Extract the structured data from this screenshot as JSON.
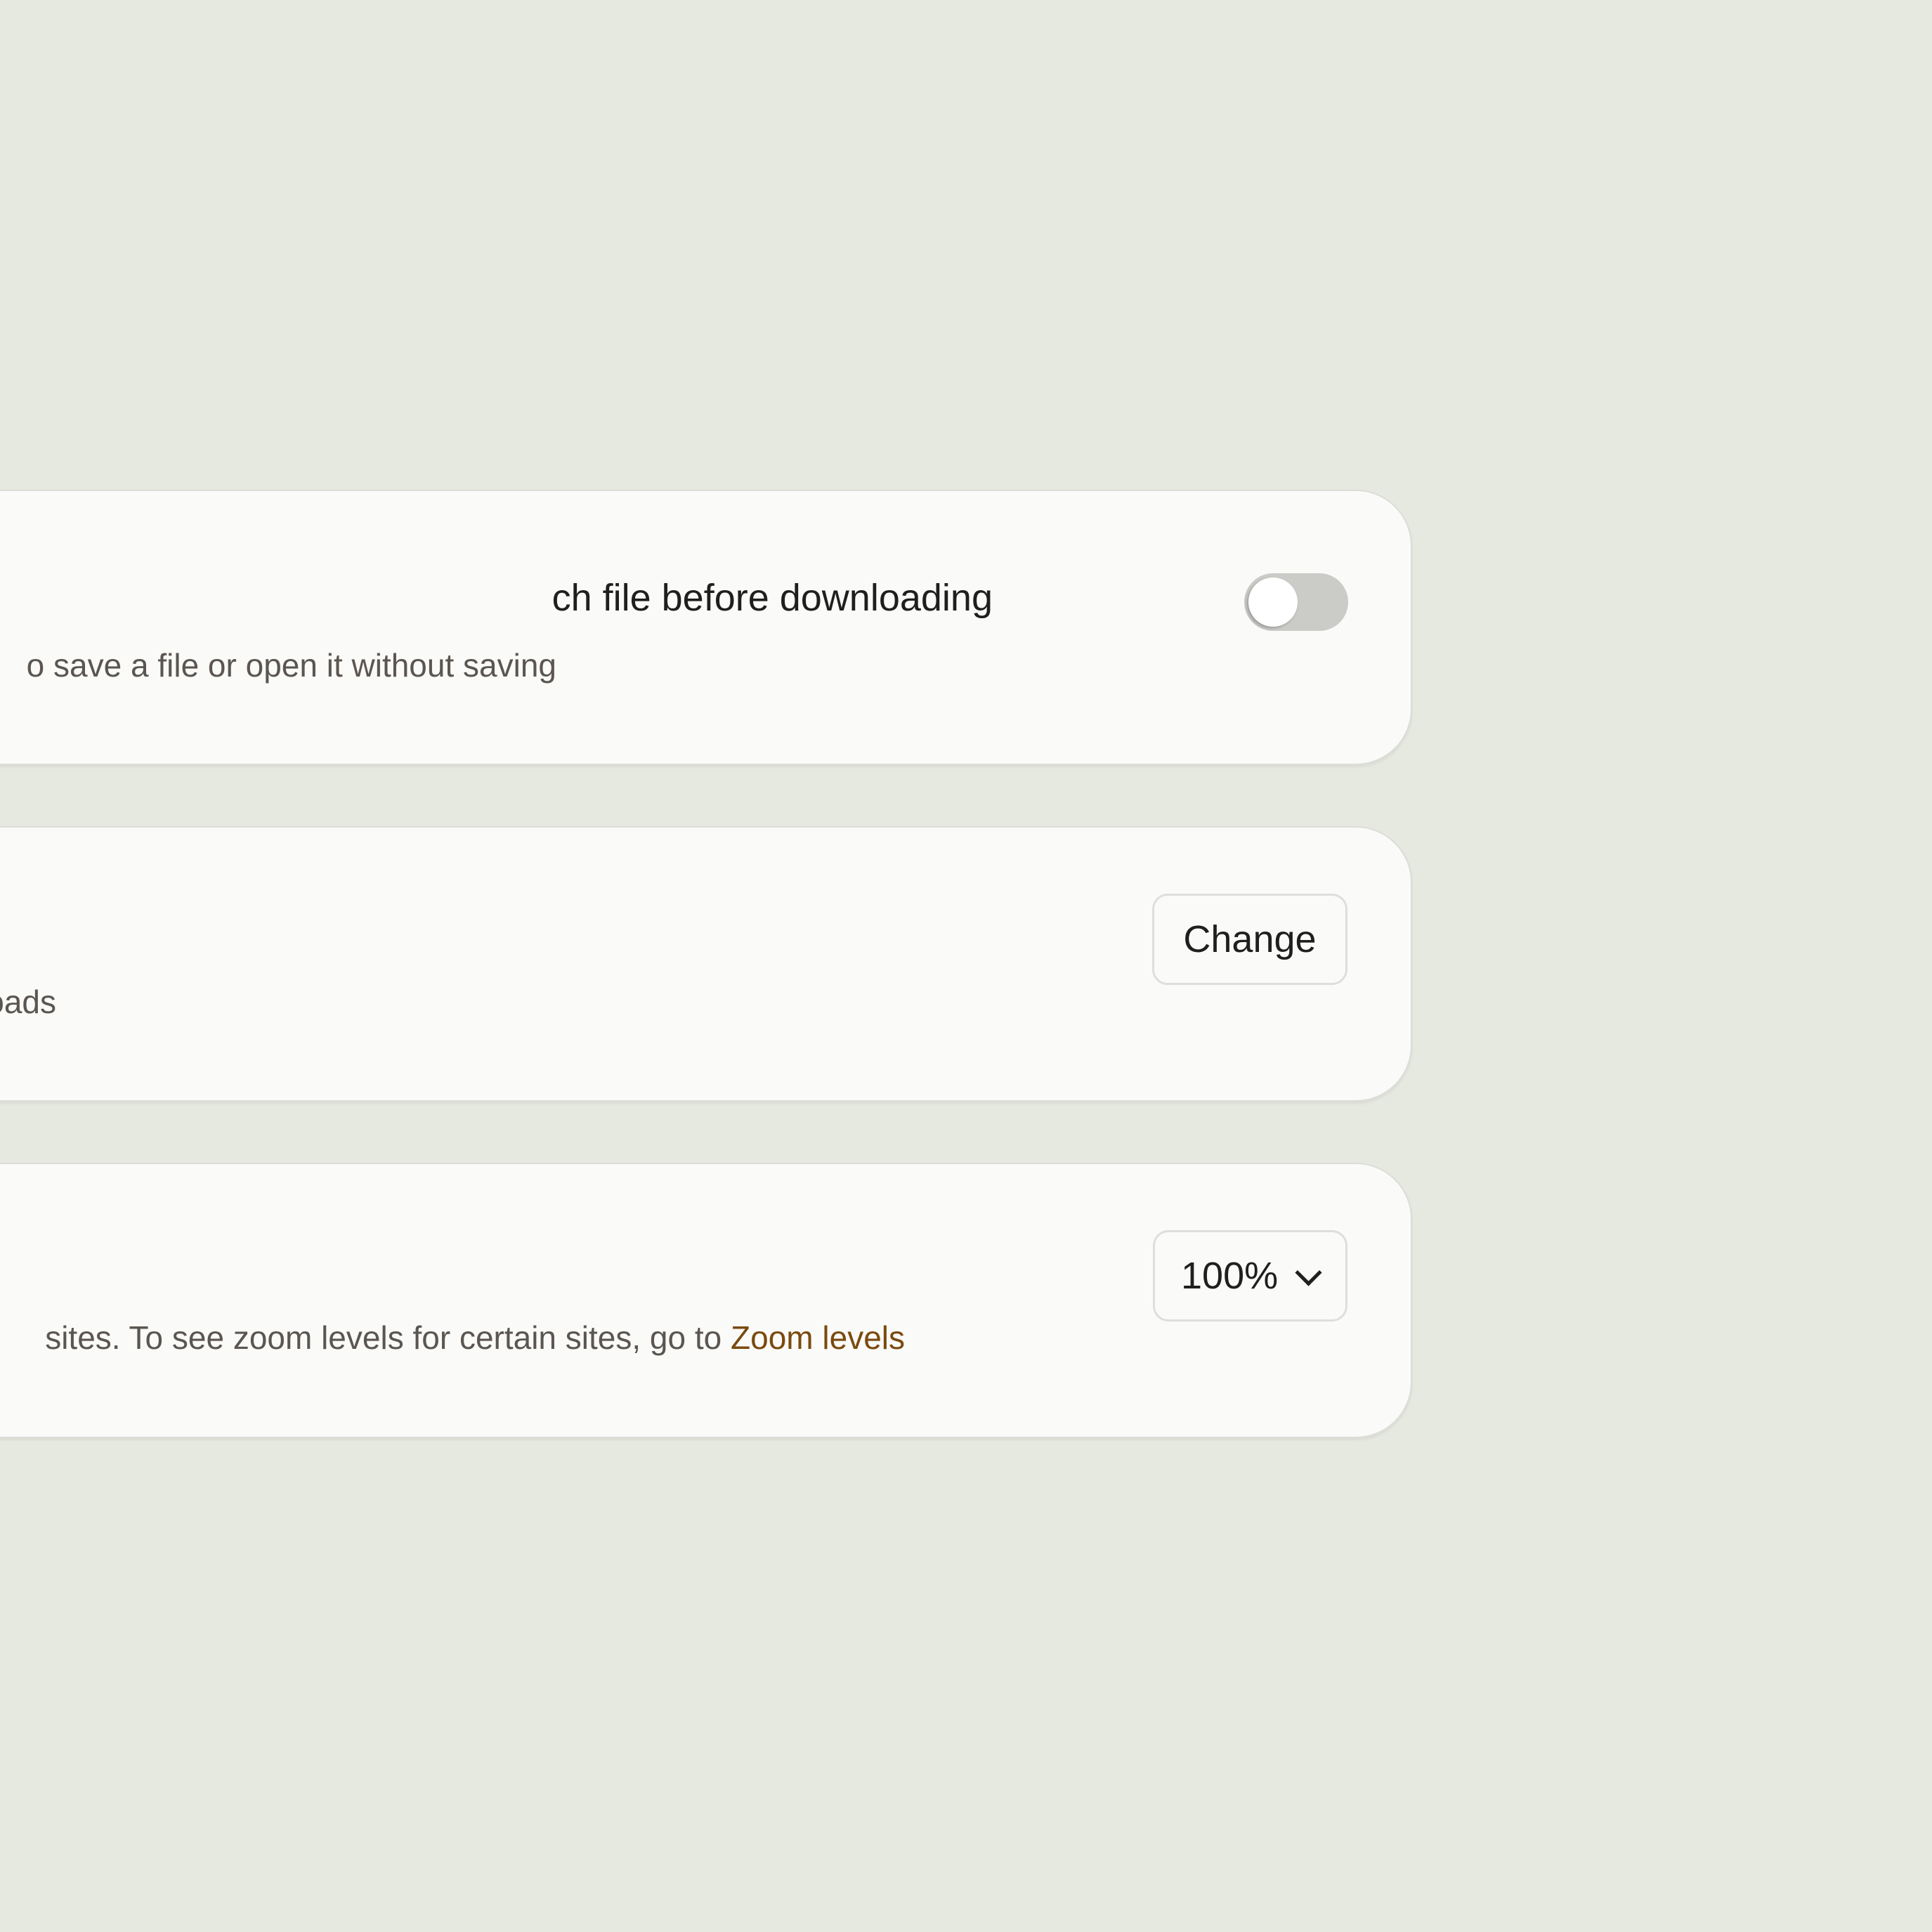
{
  "settings": {
    "ask_download": {
      "title": "ch file before downloading",
      "description": "o save a file or open it without saving",
      "toggle_on": false
    },
    "download_location": {
      "description": "oads",
      "button_label": "Change"
    },
    "page_zoom": {
      "description": " sites. To see zoom levels for certain sites, go to ",
      "link_label": "Zoom levels",
      "selected_value": "100%",
      "chevron_icon": "chevron-down-icon"
    }
  },
  "colors": {
    "background": "#e6e9e0",
    "card": "#fafaf8",
    "link": "#7a4a0e",
    "toggle_off": "#cbcbc8"
  }
}
